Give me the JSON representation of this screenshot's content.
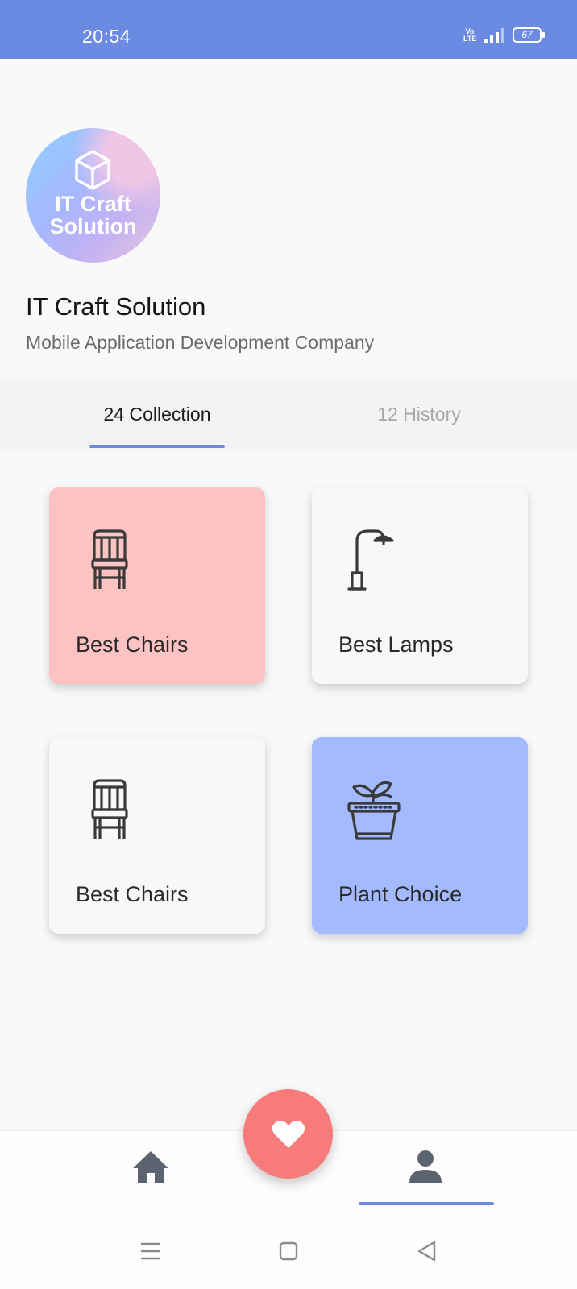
{
  "status_bar": {
    "time": "20:54",
    "volte": [
      "Vo",
      "LTE"
    ],
    "battery": "67",
    "bg_color": "#6b8be3"
  },
  "profile": {
    "logo_text_line1": "IT Craft",
    "logo_text_line2": "Solution",
    "name": "IT Craft Solution",
    "subtitle": "Mobile Application Development Company"
  },
  "tabs": [
    {
      "label": "24 Collection",
      "active": true
    },
    {
      "label": "12 History",
      "active": false
    }
  ],
  "collections": [
    {
      "label": "Best Chairs",
      "icon": "chair-icon",
      "bg": "#fdc3c3"
    },
    {
      "label": "Best Lamps",
      "icon": "lamp-icon",
      "bg": "#f8f8f8"
    },
    {
      "label": "Best Chairs",
      "icon": "chair-icon",
      "bg": "#f8f8f8"
    },
    {
      "label": "Plant Choice",
      "icon": "plant-icon",
      "bg": "#a3baff"
    }
  ],
  "bottom_nav": {
    "items": [
      {
        "icon": "home-icon",
        "active": false
      },
      {
        "icon": "heart-icon",
        "active": false
      },
      {
        "icon": "person-icon",
        "active": true
      }
    ],
    "accent": "#6b8be3",
    "fab_color": "#f77b7b"
  },
  "system_nav": {
    "buttons": [
      "menu-icon",
      "home-square-icon",
      "back-icon"
    ]
  }
}
